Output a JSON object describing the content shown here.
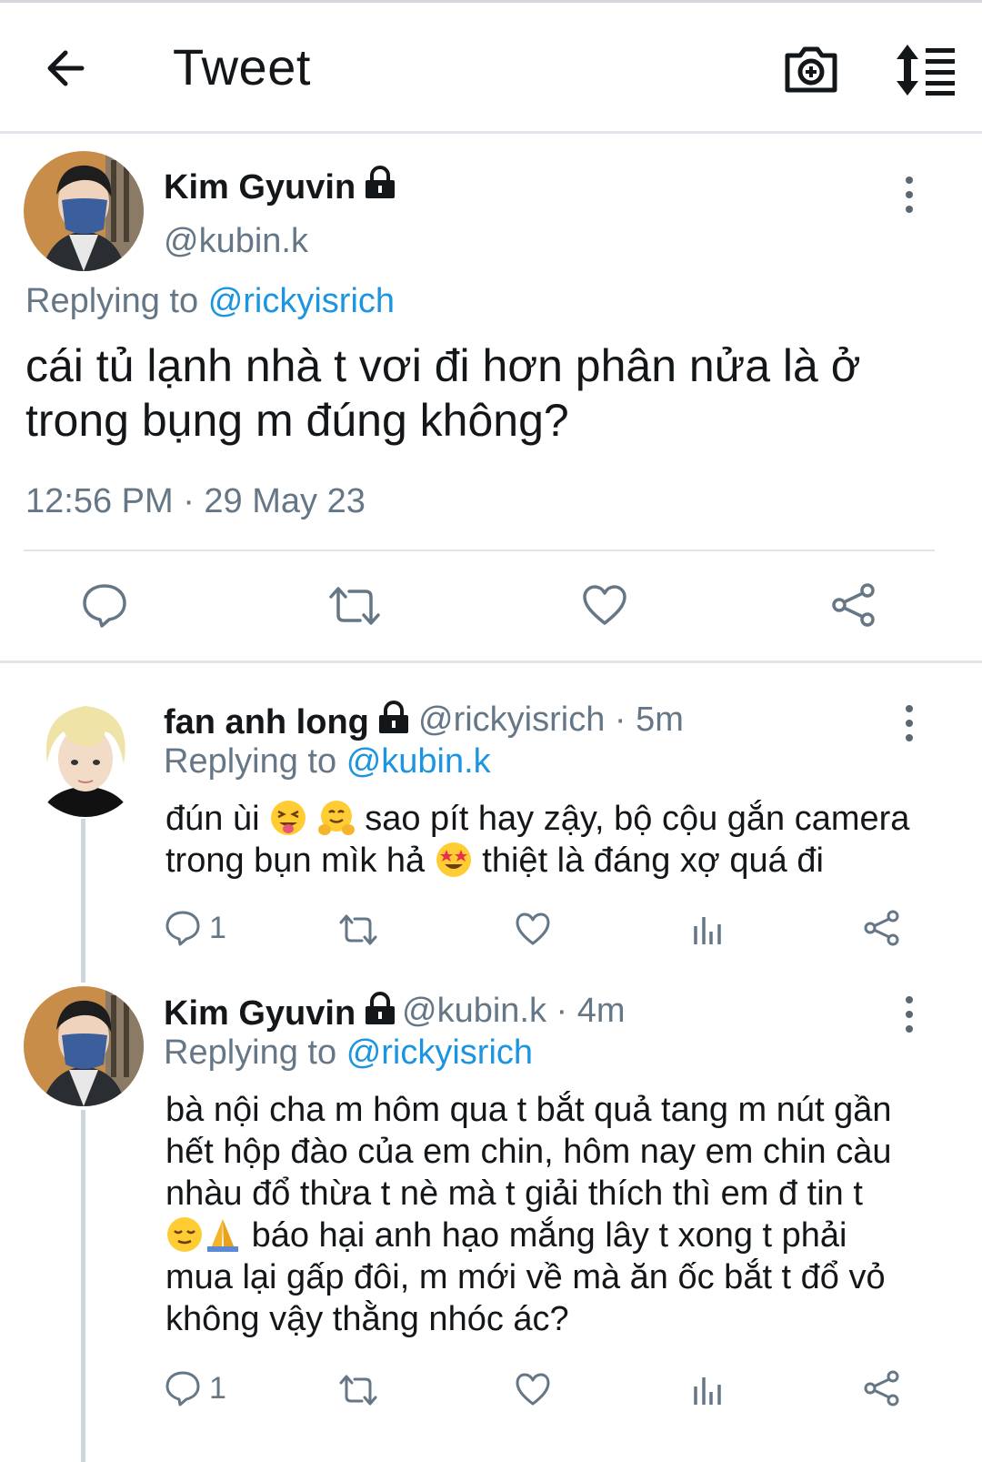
{
  "header": {
    "title": "Tweet",
    "back_icon": "arrow-left-icon",
    "camera_icon": "camera-plus-icon",
    "sort_icon": "sort-icon"
  },
  "main_tweet": {
    "name": "Kim Gyuvin",
    "handle": "@kubin.k",
    "replying_label": "Replying to",
    "replying_to": "@rickyisrich",
    "text_line1": "cái tủ lạnh nhà t vơi đi hơn phân nửa là ở",
    "text_line2": "trong bụng m đúng không?",
    "timestamp": "12:56 PM · 29 May 23"
  },
  "replies": [
    {
      "name": "fan anh long",
      "handle": "@rickyisrich · 5m",
      "replying_label": "Replying to",
      "replying_to": "@kubin.k",
      "line1a": "đún ùi",
      "line1b": "sao pít hay zậy, bộ cộu gắn camera",
      "line2a": "trong bụn mìk hả",
      "line2b": "thiệt là đáng xợ quá đi",
      "reply_count": "1"
    },
    {
      "name": "Kim Gyuvin",
      "handle": "@kubin.k · 4m",
      "replying_label": "Replying to",
      "replying_to": "@rickyisrich",
      "line1": "bà nội cha m hôm qua t bắt quả tang m nút gần",
      "line2": "hết hộp đào của em chin, hôm nay em chin càu",
      "line3": "nhàu đổ thừa t nè mà t giải thích thì em đ tin t",
      "line4": "báo hại anh hạo mắng lây t xong t phải",
      "line5": "mua lại gấp đôi, m mới về mà ăn ốc bắt t đổ vỏ",
      "line6": "không vậy thằng nhóc ác?",
      "reply_count": "1"
    }
  ],
  "colors": {
    "link": "#1b95e0",
    "secondary": "#657786",
    "divider": "#e1e5e9",
    "thread": "#ccd6dd"
  }
}
